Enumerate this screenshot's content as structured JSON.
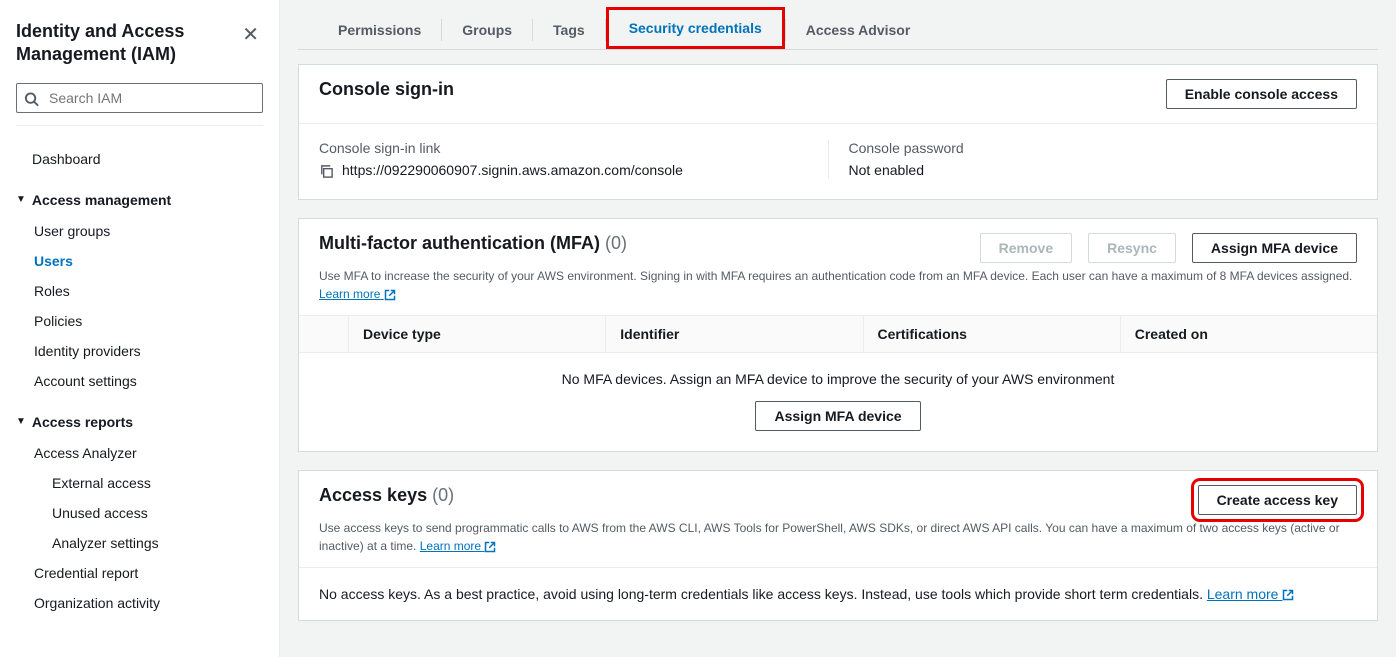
{
  "sidebar": {
    "title": "Identity and Access Management (IAM)",
    "search_placeholder": "Search IAM",
    "items": {
      "dashboard": "Dashboard",
      "access_mgmt": "Access management",
      "user_groups": "User groups",
      "users": "Users",
      "roles": "Roles",
      "policies": "Policies",
      "identity_providers": "Identity providers",
      "account_settings": "Account settings",
      "access_reports": "Access reports",
      "access_analyzer": "Access Analyzer",
      "external_access": "External access",
      "unused_access": "Unused access",
      "analyzer_settings": "Analyzer settings",
      "credential_report": "Credential report",
      "organization_activity": "Organization activity"
    }
  },
  "tabs": {
    "permissions": "Permissions",
    "groups": "Groups",
    "tags": "Tags",
    "security_credentials": "Security credentials",
    "access_advisor": "Access Advisor"
  },
  "console_signin": {
    "title": "Console sign-in",
    "enable_btn": "Enable console access",
    "link_label": "Console sign-in link",
    "link_value": "https://092290060907.signin.aws.amazon.com/console",
    "password_label": "Console password",
    "password_value": "Not enabled"
  },
  "mfa": {
    "title": "Multi-factor authentication (MFA)",
    "count": "(0)",
    "desc": "Use MFA to increase the security of your AWS environment. Signing in with MFA requires an authentication code from an MFA device. Each user can have a maximum of 8 MFA devices assigned. ",
    "learn_more": "Learn more",
    "remove_btn": "Remove",
    "resync_btn": "Resync",
    "assign_btn": "Assign MFA device",
    "cols": {
      "device_type": "Device type",
      "identifier": "Identifier",
      "certifications": "Certifications",
      "created_on": "Created on"
    },
    "empty_msg": "No MFA devices. Assign an MFA device to improve the security of your AWS environment",
    "empty_btn": "Assign MFA device"
  },
  "access_keys": {
    "title": "Access keys",
    "count": "(0)",
    "desc": "Use access keys to send programmatic calls to AWS from the AWS CLI, AWS Tools for PowerShell, AWS SDKs, or direct AWS API calls. You can have a maximum of two access keys (active or inactive) at a time. ",
    "learn_more": "Learn more",
    "create_btn": "Create access key",
    "empty_msg": "No access keys. As a best practice, avoid using long-term credentials like access keys. Instead, use tools which provide short term credentials. ",
    "empty_learn_more": "Learn more"
  }
}
